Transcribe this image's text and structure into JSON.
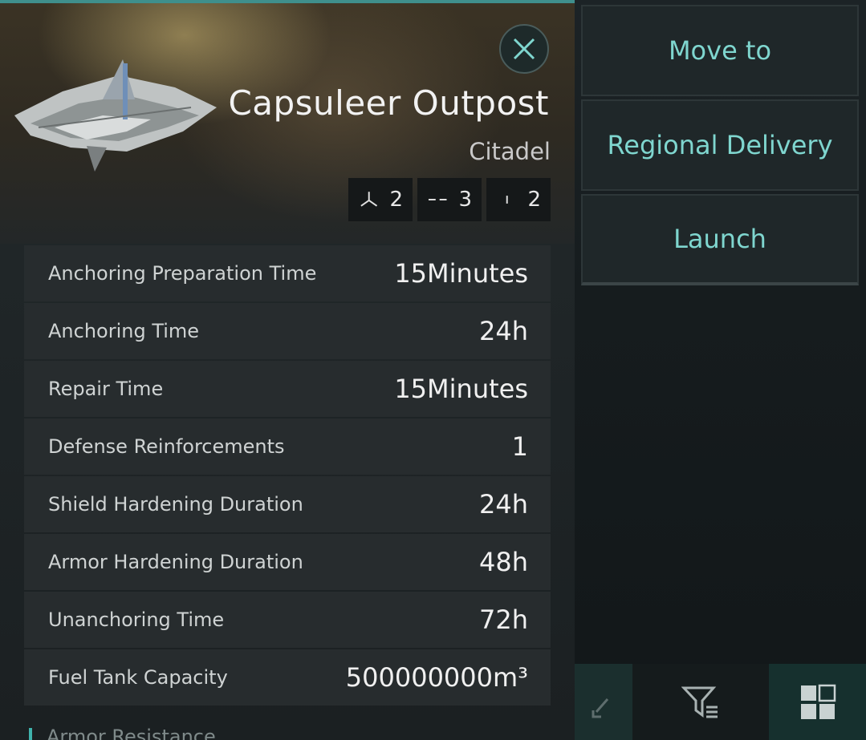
{
  "header": {
    "title": "Capsuleer Outpost",
    "subtitle": "Citadel"
  },
  "slots": [
    {
      "icon": "tri-blade-icon",
      "value": "2"
    },
    {
      "icon": "dash-line-icon",
      "value": "3"
    },
    {
      "icon": "single-bar-icon",
      "value": "2"
    }
  ],
  "stats": [
    {
      "label": "Anchoring Preparation Time",
      "value": "15Minutes"
    },
    {
      "label": "Anchoring Time",
      "value": "24h"
    },
    {
      "label": "Repair Time",
      "value": "15Minutes"
    },
    {
      "label": "Defense Reinforcements",
      "value": "1"
    },
    {
      "label": "Shield Hardening Duration",
      "value": "24h"
    },
    {
      "label": "Armor Hardening Duration",
      "value": "48h"
    },
    {
      "label": "Unanchoring Time",
      "value": "72h"
    },
    {
      "label": "Fuel Tank Capacity",
      "value": "500000000m³"
    }
  ],
  "next_section": {
    "label": "Armor Resistance"
  },
  "menu": [
    {
      "label": "Move to"
    },
    {
      "label": "Regional Delivery"
    },
    {
      "label": "Launch"
    }
  ],
  "colors": {
    "accent": "#7fd6cf",
    "panel": "#272c2e"
  }
}
